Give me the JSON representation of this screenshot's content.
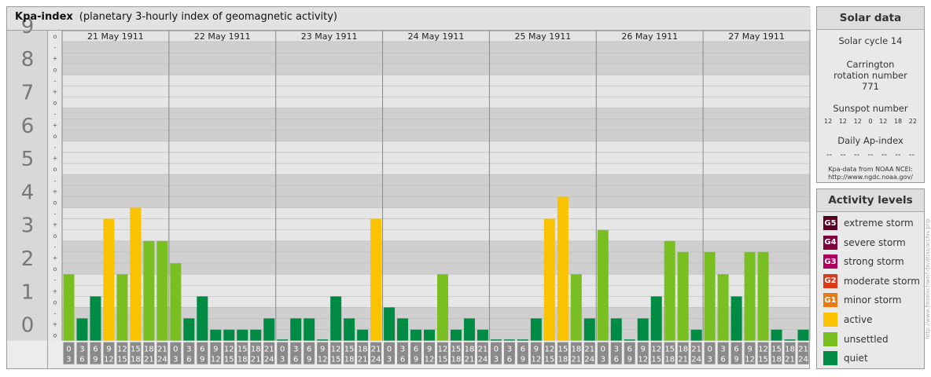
{
  "header": {
    "title": "Kpa-index",
    "subtitle": "(planetary 3-hourly index of geomagnetic activity)"
  },
  "chart_data": {
    "type": "bar",
    "title": "Kpa-index",
    "subtitle": "(planetary 3-hourly index of geomagnetic activity)",
    "ylim": [
      0,
      9
    ],
    "y_ticks": [
      "0",
      "1",
      "2",
      "3",
      "4",
      "5",
      "6",
      "7",
      "8",
      "9"
    ],
    "sub_ticks": [
      "o",
      "+",
      "-"
    ],
    "days": [
      "21 May 1911",
      "22 May 1911",
      "23 May 1911",
      "24 May 1911",
      "25 May 1911",
      "26 May 1911",
      "27 May 1911"
    ],
    "interval_starts": [
      "0",
      "3",
      "6",
      "9",
      "12",
      "15",
      "18",
      "21"
    ],
    "interval_ends": [
      "3",
      "6",
      "9",
      "12",
      "15",
      "18",
      "21",
      "24"
    ],
    "values": [
      [
        2.0,
        0.67,
        1.33,
        3.67,
        2.0,
        4.0,
        3.0,
        3.0
      ],
      [
        2.33,
        0.67,
        1.33,
        0.33,
        0.33,
        0.33,
        0.33,
        0.67
      ],
      [
        0.0,
        0.67,
        0.67,
        0.0,
        1.33,
        0.67,
        0.33,
        3.67
      ],
      [
        1.0,
        0.67,
        0.33,
        0.33,
        2.0,
        0.33,
        0.67,
        0.33
      ],
      [
        0.0,
        0.0,
        0.0,
        0.67,
        3.67,
        4.33,
        2.0,
        0.67
      ],
      [
        3.33,
        0.67,
        0.0,
        0.67,
        1.33,
        3.0,
        2.67,
        0.33
      ],
      [
        2.67,
        2.0,
        1.33,
        2.67,
        2.67,
        0.33,
        0.0,
        0.33
      ]
    ],
    "colors": {
      "quiet": "#008b45",
      "unsettled": "#7abf22",
      "active": "#f9c300"
    },
    "grid": true,
    "legend": "right"
  },
  "solar_data": {
    "heading": "Solar data",
    "solar_cycle": "Solar cycle 14",
    "carrington": "Carrington rotation number 771",
    "sunspot_label": "Sunspot number",
    "sunspot_values": [
      "12",
      "12",
      "12",
      "0",
      "12",
      "18",
      "22"
    ],
    "ap_label": "Daily Ap-index",
    "ap_values": [
      "--",
      "--",
      "--",
      "--",
      "--",
      "--",
      "--"
    ],
    "credit_line1": "Kpa-data from NOAA NCEI:",
    "credit_line2": "http://www.ngdc.noaa.gov/"
  },
  "activity_levels": {
    "heading": "Activity levels",
    "items": [
      {
        "code": "G5",
        "label": "extreme storm",
        "color": "#5a0024"
      },
      {
        "code": "G4",
        "label": "severe storm",
        "color": "#800040"
      },
      {
        "code": "G3",
        "label": "strong storm",
        "color": "#b0005e"
      },
      {
        "code": "G2",
        "label": "moderate storm",
        "color": "#d93a19"
      },
      {
        "code": "G1",
        "label": "minor storm",
        "color": "#e87a14"
      },
      {
        "code": "",
        "label": "active",
        "color": "#f9c300"
      },
      {
        "code": "",
        "label": "unsettled",
        "color": "#7abf22"
      },
      {
        "code": "",
        "label": "quiet",
        "color": "#008b45"
      }
    ]
  },
  "vertical_credit": "http://www.fieselschweif.de/atlas/archiv.php"
}
